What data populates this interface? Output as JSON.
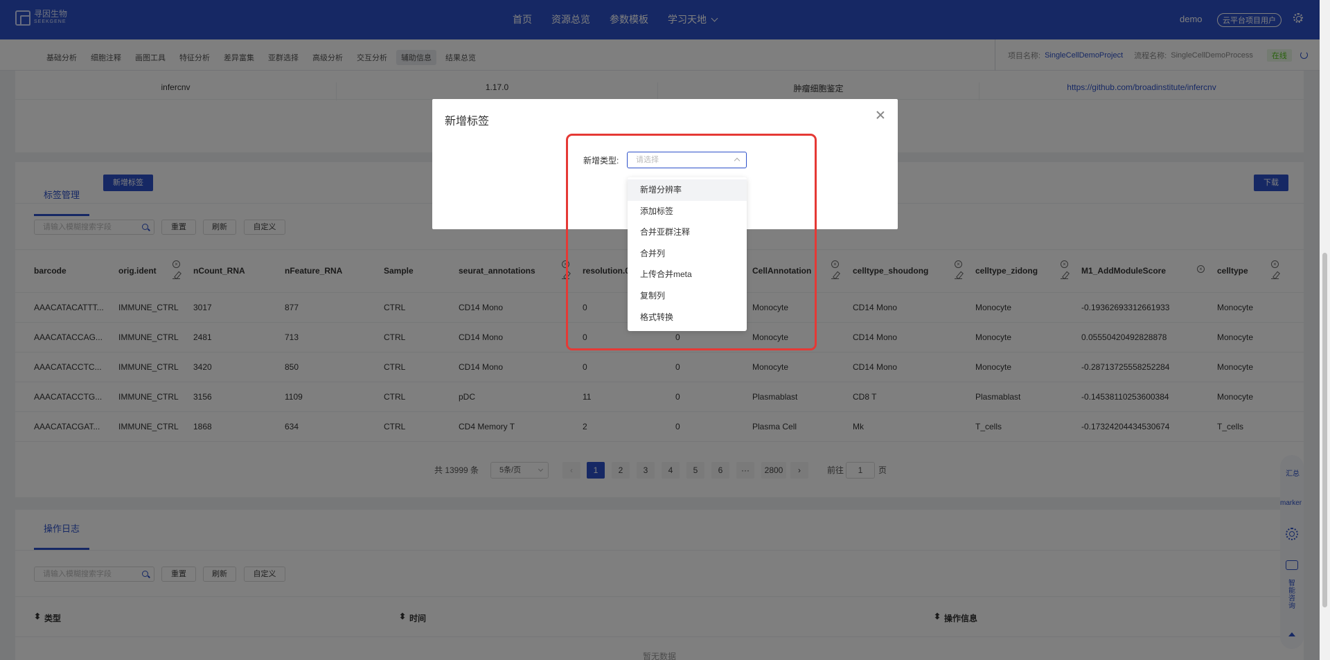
{
  "header": {
    "logo_cn": "寻因生物",
    "logo_en": "SEEKGENE",
    "nav": [
      "首页",
      "资源总览",
      "参数模板",
      "学习天地"
    ],
    "user": "demo",
    "user_role": "云平台项目用户"
  },
  "subnav": {
    "tabs": [
      "基础分析",
      "细胞注释",
      "画图工具",
      "特征分析",
      "差异富集",
      "亚群选择",
      "高级分析",
      "交互分析",
      "辅助信息",
      "结果总览"
    ],
    "active": "辅助信息",
    "project_label": "项目名称:",
    "project_name": "SingleCellDemoProject",
    "process_label": "流程名称:",
    "process_name": "SingleCellDemoProcess",
    "status": "在线"
  },
  "tools_row": {
    "name": "infercnv",
    "version": "1.17.0",
    "purpose": "肿瘤细胞鉴定",
    "url": "https://github.com/broadinstitute/infercnv"
  },
  "label_mgmt": {
    "tab": "标签管理",
    "add_btn": "新增标签",
    "download_btn": "下载",
    "search_placeholder": "请输入模糊搜索字段",
    "reset": "重置",
    "refresh": "刷新",
    "custom": "自定义",
    "columns": [
      "barcode",
      "orig.ident",
      "nCount_RNA",
      "nFeature_RNA",
      "Sample",
      "seurat_annotations",
      "resolution.0",
      "",
      "CellAnnotation",
      "celltype_shoudong",
      "celltype_zidong",
      "M1_AddModuleScore",
      "celltype"
    ],
    "rows": [
      [
        "AAACATACATTT...",
        "IMMUNE_CTRL",
        "3017",
        "877",
        "CTRL",
        "CD14 Mono",
        "0",
        "0",
        "Monocyte",
        "CD14 Mono",
        "Monocyte",
        "-0.19362693312661933",
        "Monocyte"
      ],
      [
        "AAACATACCAG...",
        "IMMUNE_CTRL",
        "2481",
        "713",
        "CTRL",
        "CD14 Mono",
        "0",
        "0",
        "Monocyte",
        "CD14 Mono",
        "Monocyte",
        "0.05550420492828878",
        "Monocyte"
      ],
      [
        "AAACATACCTC...",
        "IMMUNE_CTRL",
        "3420",
        "850",
        "CTRL",
        "CD14 Mono",
        "0",
        "0",
        "Monocyte",
        "CD14 Mono",
        "Monocyte",
        "-0.28713725558252284",
        "Monocyte"
      ],
      [
        "AAACATACCTG...",
        "IMMUNE_CTRL",
        "3156",
        "1109",
        "CTRL",
        "pDC",
        "11",
        "0",
        "Plasmablast",
        "CD8 T",
        "Plasmablast",
        "-0.14538110253600384",
        "Monocyte"
      ],
      [
        "AAACATACGAT...",
        "IMMUNE_CTRL",
        "1868",
        "634",
        "CTRL",
        "CD4 Memory T",
        "2",
        "0",
        "Plasma Cell",
        "Mk",
        "T_cells",
        "-0.17324204434530674",
        "T_cells"
      ]
    ],
    "pagination": {
      "total": "共 13999 条",
      "page_size": "5条/页",
      "pages": [
        "1",
        "2",
        "3",
        "4",
        "5",
        "6",
        "···",
        "2800"
      ],
      "current": 1,
      "goto_label": "前往",
      "goto_value": "1",
      "page_suffix": "页"
    }
  },
  "op_log": {
    "tab": "操作日志",
    "search_placeholder": "请输入模糊搜索字段",
    "reset": "重置",
    "refresh": "刷新",
    "custom": "自定义",
    "columns": [
      "类型",
      "时间",
      "操作信息"
    ],
    "empty": "暂无数据"
  },
  "floating": {
    "summary": "汇总",
    "marker": "marker",
    "consult": "智能咨询"
  },
  "modal": {
    "title": "新增标签",
    "type_label": "新增类型:",
    "select_placeholder": "请选择",
    "options": [
      "新增分辨率",
      "添加标签",
      "合并亚群注释",
      "合并列",
      "上传合并meta",
      "复制列",
      "格式转换"
    ]
  },
  "colors": {
    "primary": "#2c50c9",
    "highlight": "#e53935"
  }
}
